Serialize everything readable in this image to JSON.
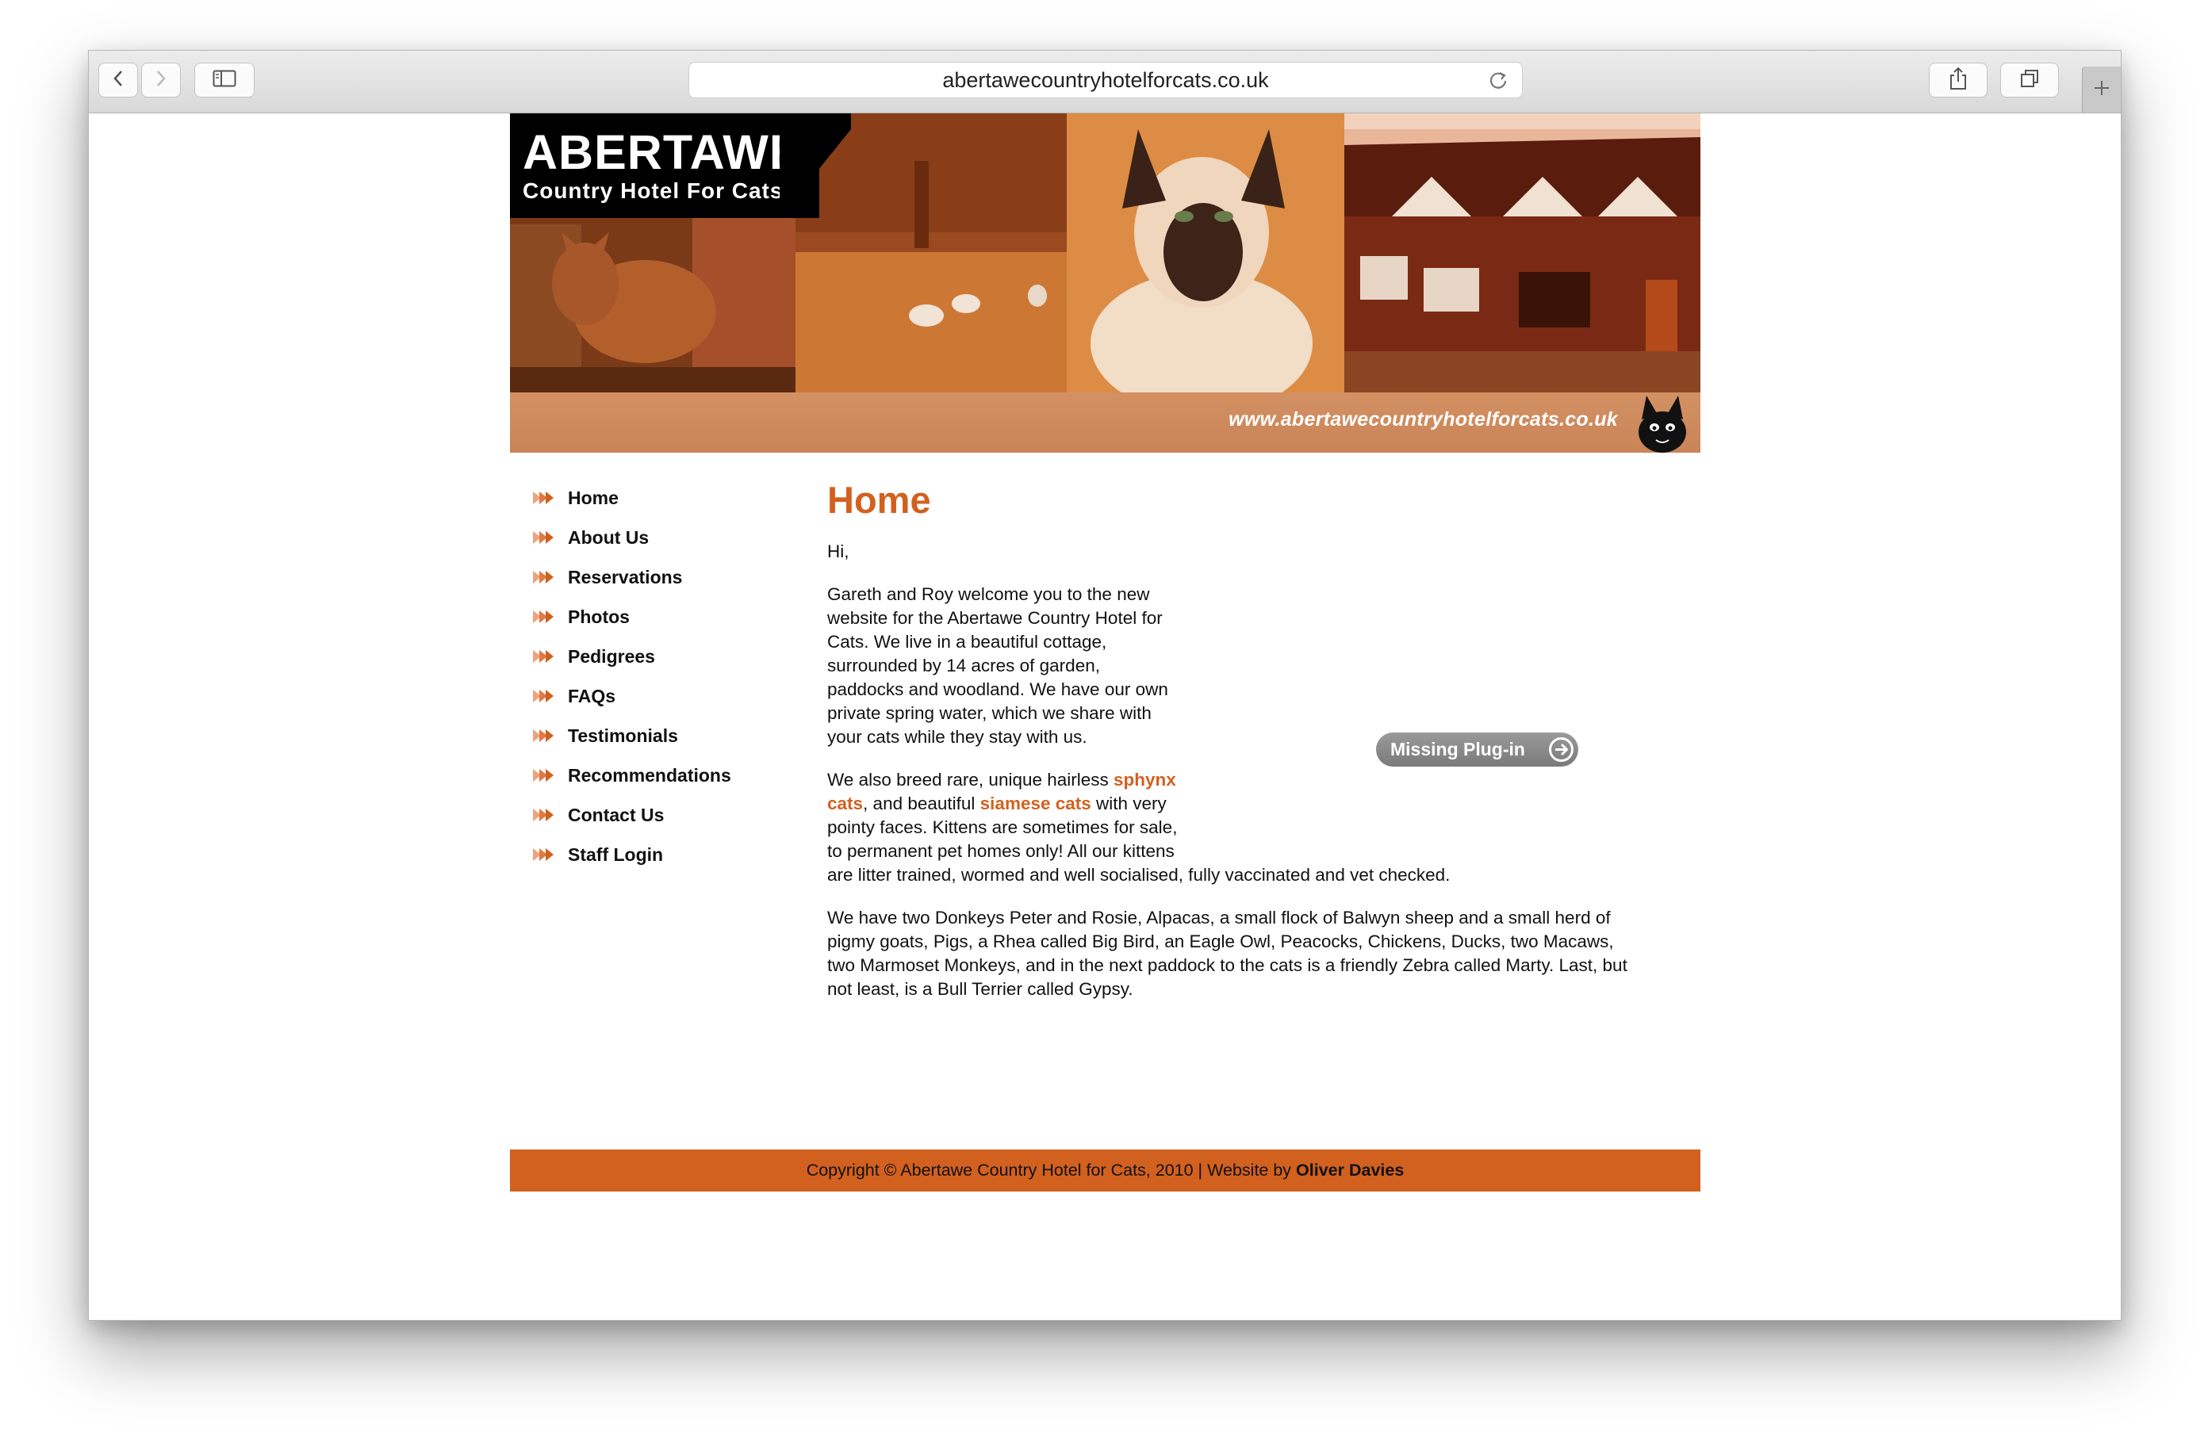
{
  "browser": {
    "url": "abertawecountryhotelforcats.co.uk",
    "icons": [
      "back-icon",
      "forward-icon",
      "sidebar-icon",
      "reload-icon",
      "share-icon",
      "tabs-icon",
      "new-tab-icon"
    ]
  },
  "banner": {
    "title": "ABERTAWE",
    "subtitle": "Country Hotel For Cats",
    "url_text": "www.abertawecountryhotelforcats.co.uk"
  },
  "nav": {
    "items": [
      {
        "label": "Home"
      },
      {
        "label": "About Us"
      },
      {
        "label": "Reservations"
      },
      {
        "label": "Photos"
      },
      {
        "label": "Pedigrees"
      },
      {
        "label": "FAQs"
      },
      {
        "label": "Testimonials"
      },
      {
        "label": "Recommendations"
      },
      {
        "label": "Contact Us"
      },
      {
        "label": "Staff Login"
      }
    ]
  },
  "content": {
    "heading": "Home",
    "greeting": "Hi,",
    "p1": [
      "Gareth and Roy welcome you to the new",
      "website for the Abertawe Country Hotel for",
      "Cats. We live in a beautiful cottage,",
      "surrounded by 14 acres of garden,",
      "paddocks and woodland. We have our own",
      "private spring water, which we share with",
      "your cats while they stay with us."
    ],
    "p2": {
      "t1": "We also breed rare, unique hairless ",
      "link1a": "sphynx",
      "link1b": "cats",
      "t2": ", and beautiful ",
      "link2": "siamese cats",
      "t3": " with very",
      "l3": "pointy faces. Kittens are sometimes for sale,",
      "l4": "to permanent pet homes only! All our kittens",
      "l5": "are litter trained, wormed and well socialised, fully vaccinated and vet checked."
    },
    "p3": [
      "We have two Donkeys Peter and Rosie, Alpacas, a small flock of Balwyn sheep and a small herd of",
      "pigmy goats, Pigs, a Rhea called Big Bird, an Eagle Owl, Peacocks, Chickens, Ducks, two Macaws,",
      "two Marmoset Monkeys, and in the next paddock to the cats is a friendly Zebra called Marty. Last, but",
      "not least, is a Bull Terrier called Gypsy."
    ],
    "plugin_label": "Missing Plug-in"
  },
  "footer": {
    "text": "Copyright © Abertawe Country Hotel for Cats, 2010 | Website by ",
    "author": "Oliver Davies"
  },
  "colors": {
    "accent": "#d2601f",
    "banner_strip": "#c98457"
  }
}
